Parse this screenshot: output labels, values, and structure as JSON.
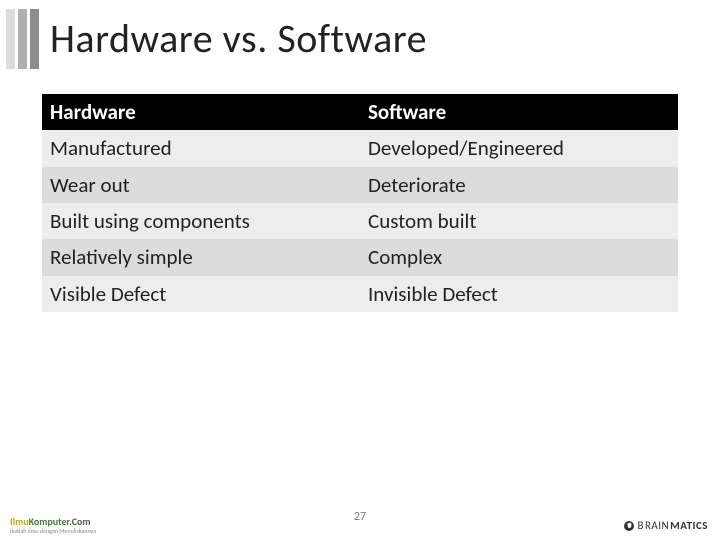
{
  "title": "Hardware vs. Software",
  "chart_data": {
    "type": "table",
    "columns": [
      "Hardware",
      "Software"
    ],
    "rows": [
      [
        "Manufactured",
        "Developed/Engineered"
      ],
      [
        "Wear out",
        "Deteriorate"
      ],
      [
        "Built using components",
        "Custom built"
      ],
      [
        "Relatively simple",
        "Complex"
      ],
      [
        "Visible Defect",
        "Invisible Defect"
      ]
    ]
  },
  "page_number": "27",
  "footer_left": {
    "part1": "Ilmu",
    "part2": "Komputer",
    "part3": ".Com",
    "tagline": "Ikatlah Ilmu dengan Menuliskannya"
  },
  "footer_right": {
    "light1": "B",
    "light2": "RAIN",
    "bold": "MATICS"
  }
}
